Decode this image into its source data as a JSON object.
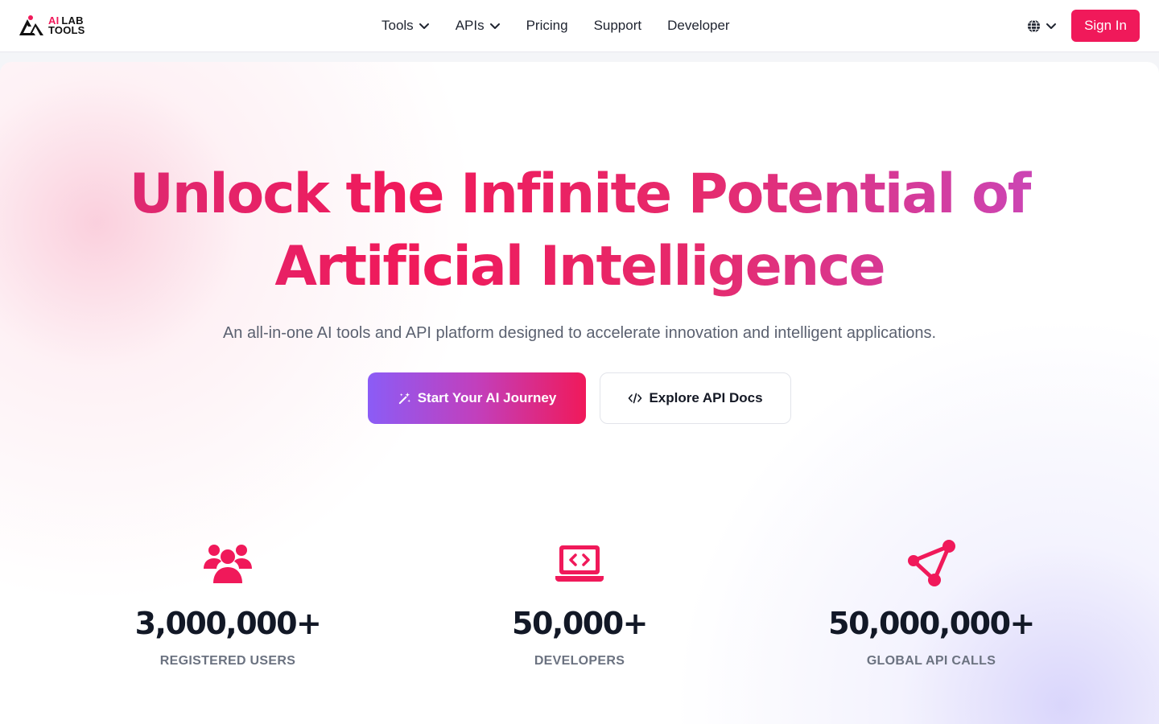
{
  "brand": {
    "ai": "AI",
    "lab": "LAB",
    "tools": "TOOLS"
  },
  "nav": {
    "tools": "Tools",
    "apis": "APIs",
    "pricing": "Pricing",
    "support": "Support",
    "developer": "Developer"
  },
  "header": {
    "sign_in": "Sign In"
  },
  "hero": {
    "headline_line1": "Unlock the Infinite Potential of",
    "headline_line2": "Artificial Intelligence",
    "subtitle": "An all-in-one AI tools and API platform designed to accelerate innovation and intelligent applications.",
    "cta_primary": "Start Your AI Journey",
    "cta_secondary": "Explore API Docs"
  },
  "stats": [
    {
      "icon": "users-icon",
      "value": "3,000,000+",
      "label": "REGISTERED USERS"
    },
    {
      "icon": "laptop-code-icon",
      "value": "50,000+",
      "label": "DEVELOPERS"
    },
    {
      "icon": "network-icon",
      "value": "50,000,000+",
      "label": "GLOBAL API CALLS"
    }
  ],
  "colors": {
    "brand_pink": "#f0195a",
    "brand_purple": "#8b5cf6",
    "text_dark": "#121826",
    "text_muted": "#6b7280"
  }
}
